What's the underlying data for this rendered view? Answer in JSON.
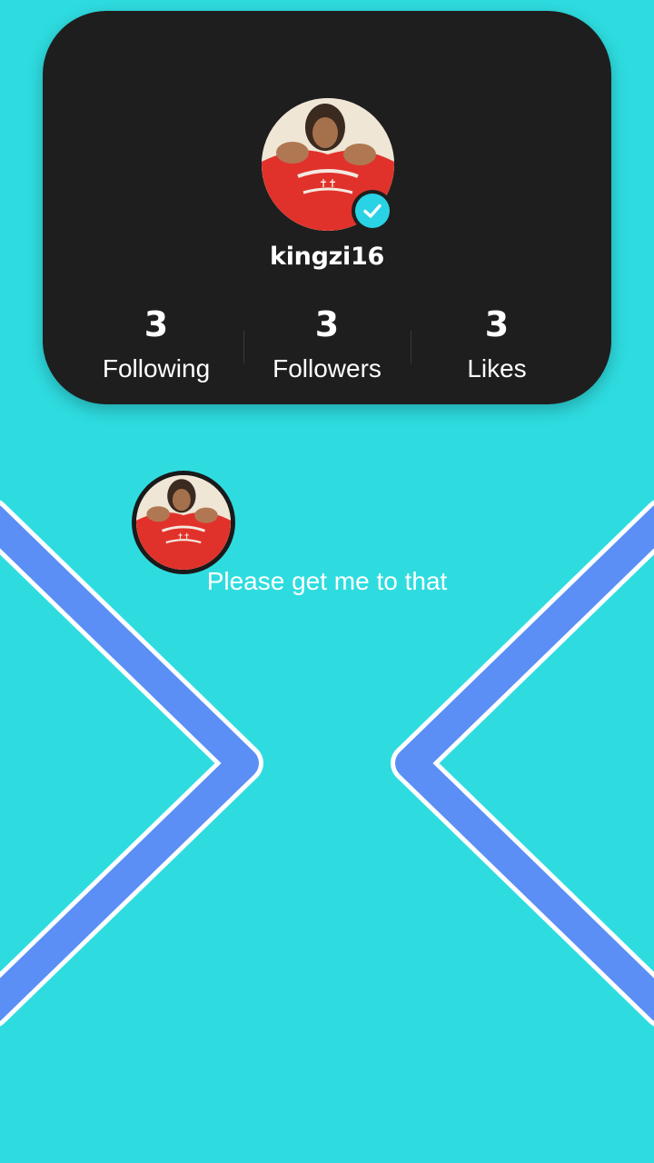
{
  "profile": {
    "username": "kingzi16",
    "avatar_icon": "profile-photo",
    "verified_icon": "verified-checkmark-icon",
    "stats": [
      {
        "value": "3",
        "label": "Following"
      },
      {
        "value": "3",
        "label": "Followers"
      },
      {
        "value": "3",
        "label": "Likes"
      }
    ]
  },
  "comment": {
    "avatar_icon": "profile-photo",
    "text": "Please get me to that"
  },
  "colors": {
    "background": "#2edce0",
    "card": "#1e1e1e",
    "chevron": "#5b8ff5",
    "chevron_outline": "#ffffff",
    "verified": "#29d3e5"
  }
}
